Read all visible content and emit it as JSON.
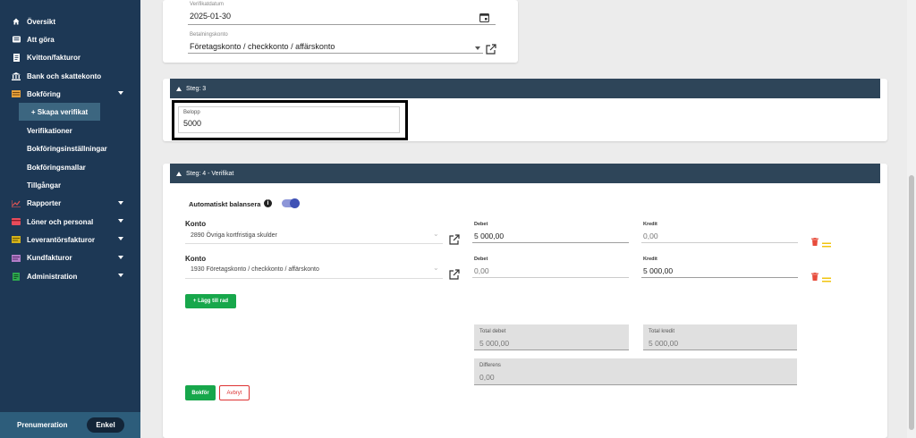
{
  "sidebar": {
    "items": [
      {
        "label": "Översikt",
        "icon": "home-icon"
      },
      {
        "label": "Att göra",
        "icon": "list-icon"
      },
      {
        "label": "Kvitton/fakturor",
        "icon": "receipt-icon"
      },
      {
        "label": "Bank och skattekonto",
        "icon": "bank-icon"
      },
      {
        "label": "Bokföring",
        "icon": "ledger-icon"
      }
    ],
    "active_sub": "+ Skapa verifikat",
    "sub_items": [
      "Verifikationer",
      "Bokföringsinställningar",
      "Bokföringsmallar",
      "Tillgångar"
    ],
    "items_after": [
      {
        "label": "Rapporter",
        "icon": "chart-icon"
      },
      {
        "label": "Löner och personal",
        "icon": "payroll-icon"
      },
      {
        "label": "Leverantörsfakturor",
        "icon": "supplier-invoice-icon"
      },
      {
        "label": "Kundfakturor",
        "icon": "customer-invoice-icon"
      },
      {
        "label": "Administration",
        "icon": "admin-icon"
      }
    ],
    "footer_label": "Prenumeration",
    "footer_plan": "Enkel"
  },
  "step_top": {
    "date_label": "Verifikatdatum",
    "date_value": "2025-01-30",
    "payment_label": "Betalningskonto",
    "payment_value": "Företagskonto / checkkonto / affärskonto"
  },
  "step3": {
    "title": "Steg: 3",
    "amount_label": "Belopp",
    "amount_value": "5000"
  },
  "step4": {
    "title": "Steg: 4 - Verifikat",
    "auto_balance_label": "Automatiskt balansera",
    "auto_balance_on": true,
    "rows": [
      {
        "account_label": "Konto",
        "account_value": "2890 Övriga kortfristiga skulder",
        "debit_label": "Debet",
        "debit_value": "5 000,00",
        "credit_label": "Kredit",
        "credit_value": "0,00"
      },
      {
        "account_label": "Konto",
        "account_value": "1930 Företagskonto / checkkonto / affärskonto",
        "debit_label": "Debet",
        "debit_value": "0,00",
        "credit_label": "Kredit",
        "credit_value": "5 000,00"
      }
    ],
    "add_row_label": "+ Lägg till rad",
    "total_debit_label": "Total debet",
    "total_debit_value": "5 000,00",
    "total_credit_label": "Total kredit",
    "total_credit_value": "5 000,00",
    "diff_label": "Differens",
    "diff_value": "0,00",
    "save_label": "Bokför",
    "cancel_label": "Avbryt"
  },
  "colors": {
    "sidebar_bg": "#1d3855",
    "step_bar": "#2e4559",
    "accent_green": "#17a74b",
    "toggle": "#3f51b5"
  }
}
